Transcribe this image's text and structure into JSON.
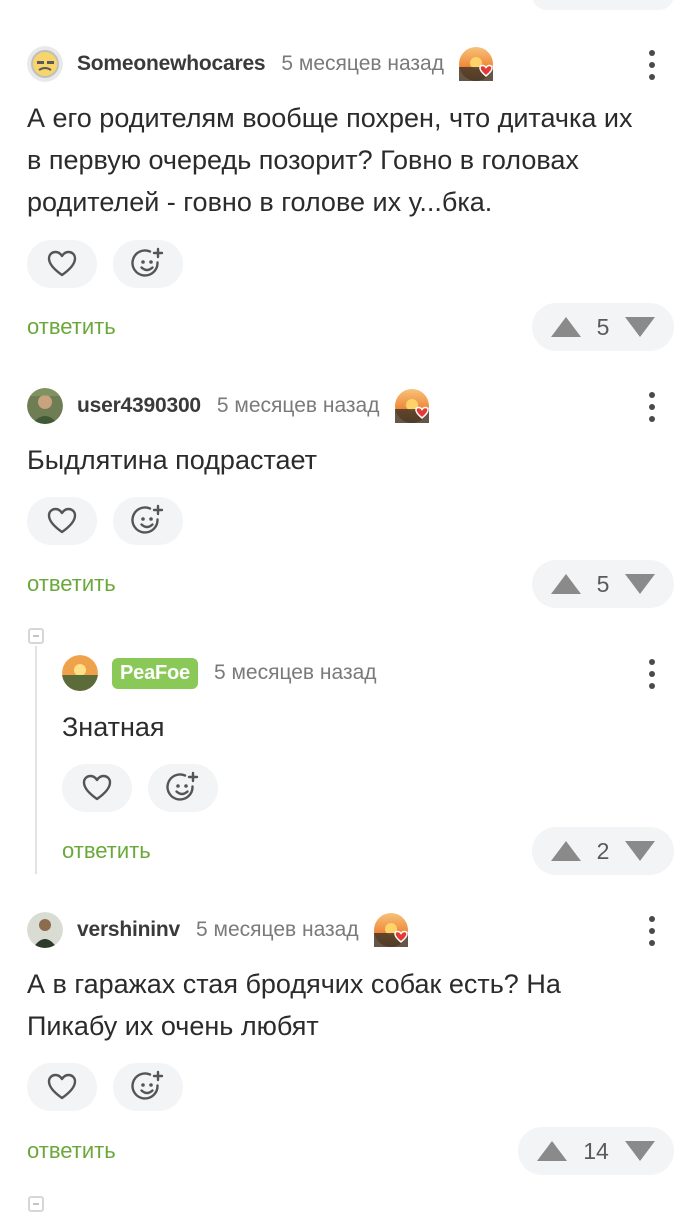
{
  "reply_label": "ответить",
  "colors": {
    "accent_green": "#6ba83c",
    "badge_green": "#8ac858",
    "pill_bg": "#f3f4f6"
  },
  "icons": {
    "like": "heart-icon",
    "react": "smiley-plus-icon",
    "upvote": "triangle-up-icon",
    "downvote": "triangle-down-icon",
    "menu": "kebab-menu-icon",
    "award": "sunset-heart-award-icon"
  },
  "comments": [
    {
      "author": "Someonewhocares",
      "time": "5 месяцев назад",
      "text": "А его родителям вообще похрен, что дитачка их\nв первую очередь позорит? Говно в головах\nродителей - говно в голове их у...бка.",
      "rating": "5"
    },
    {
      "author": "user4390300",
      "time": "5 месяцев назад",
      "text": "Быдлятина подрастает",
      "rating": "5"
    },
    {
      "author": "PeaFoe",
      "time": "5 месяцев назад",
      "text": "Знатная",
      "rating": "2"
    },
    {
      "author": "vershininv",
      "time": "5 месяцев назад",
      "text": "А в гаражах стая бродячих собак есть? На\nПикабу их очень любят",
      "rating": "14"
    }
  ]
}
